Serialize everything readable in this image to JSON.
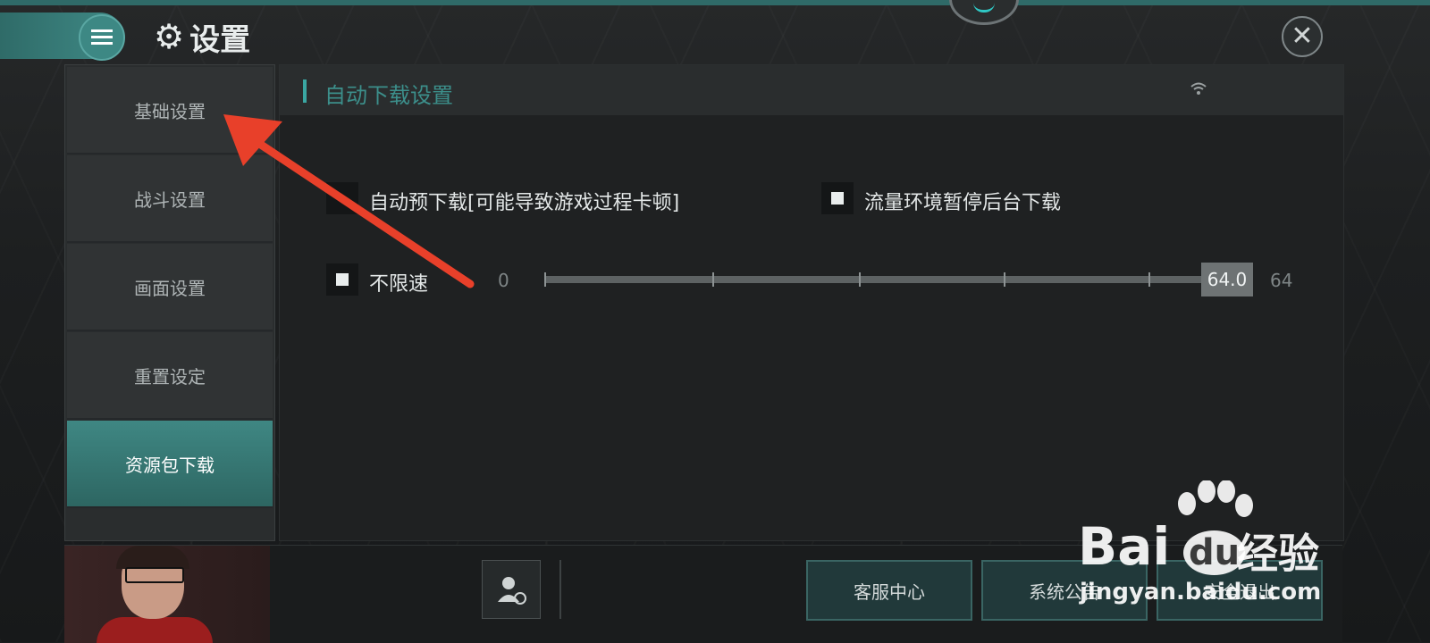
{
  "header": {
    "title": "设置"
  },
  "sidebar": {
    "items": [
      {
        "label": "基础设置"
      },
      {
        "label": "战斗设置"
      },
      {
        "label": "画面设置"
      },
      {
        "label": "重置设定"
      },
      {
        "label": "资源包下载"
      }
    ],
    "active_index": 4
  },
  "panel": {
    "title": "自动下载设置",
    "options": {
      "auto_predownload": {
        "label": "自动预下载[可能导致游戏过程卡顿]",
        "checked": false
      },
      "pause_on_cellular": {
        "label": "流量环境暂停后台下载",
        "checked": true
      },
      "unlimited_speed": {
        "label": "不限速",
        "checked": true
      }
    },
    "speed_slider": {
      "min": "0",
      "max": "64",
      "value": "64.0",
      "fraction": 1.0
    }
  },
  "bottom_bar": {
    "buttons": [
      {
        "label": "客服中心"
      },
      {
        "label": "系统公告"
      },
      {
        "label": "安全退出"
      }
    ]
  },
  "watermark": {
    "brand": "Bai",
    "brand_du": "du",
    "brand_cn": "经验",
    "url": "jingyan.baidu.com"
  },
  "colors": {
    "accent": "#3aa7a3",
    "arrow": "#e8402a"
  }
}
